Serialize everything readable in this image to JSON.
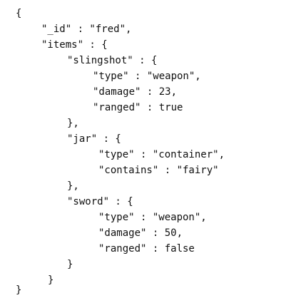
{
  "document": {
    "lines": [
      "{",
      "\"_id\" : \"fred\",",
      "\"items\" : {",
      "\"slingshot\" : {",
      "\"type\" : \"weapon\",",
      "\"damage\" : 23,",
      "\"ranged\" : true",
      "},",
      "\"jar\" : {",
      "\"type\" : \"container\",",
      "\"contains\" : \"fairy\"",
      "},",
      "\"sword\" : {",
      "\"type\" : \"weapon\",",
      "\"damage\" : 50,",
      "\"ranged\" : false",
      "}",
      "}",
      "}"
    ]
  }
}
